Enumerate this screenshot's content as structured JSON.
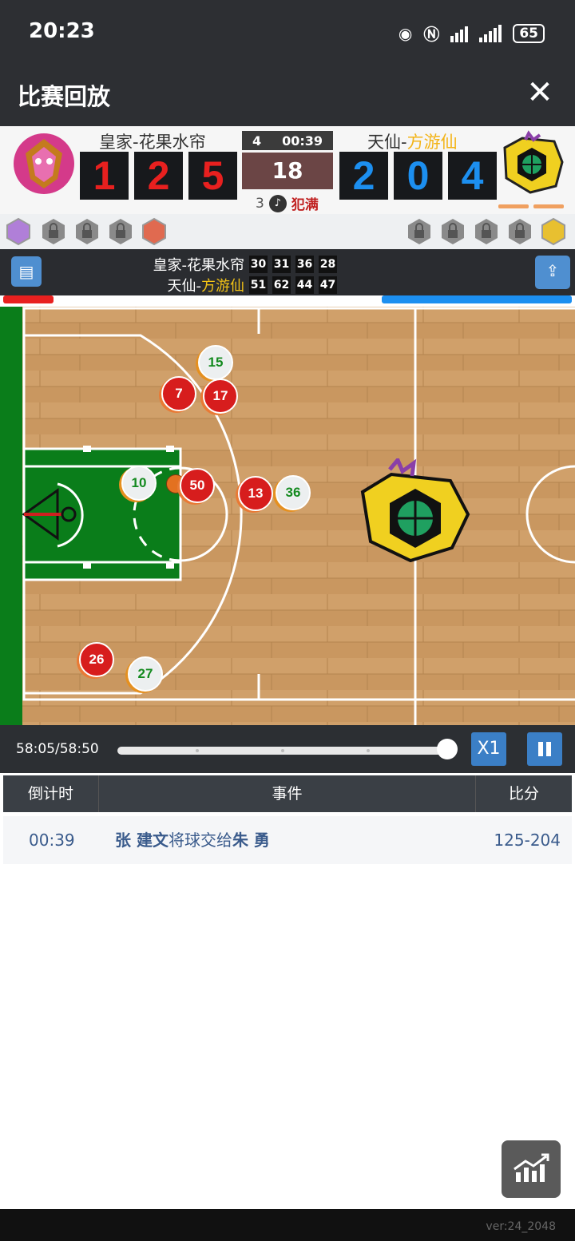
{
  "status_bar": {
    "time": "20:23",
    "battery": "65"
  },
  "header": {
    "title": "比赛回放",
    "close_label": "✕"
  },
  "scoreboard": {
    "home": {
      "name_prefix": "皇家-",
      "name": "花果水帘",
      "score_digits": [
        "1",
        "2",
        "5"
      ]
    },
    "away": {
      "name_prefix": "天仙-",
      "name": "方游仙",
      "score_digits": [
        "2",
        "0",
        "4"
      ]
    },
    "period": "4",
    "game_clock": "00:39",
    "shot_clock": "18",
    "fouls": "3",
    "foul_status": "犯满"
  },
  "quarter_scores": {
    "home": {
      "name_prefix": "皇家-",
      "name": "花果水帘",
      "scores": [
        "30",
        "31",
        "36",
        "28"
      ]
    },
    "away": {
      "name_prefix": "天仙-",
      "name": "方游仙",
      "scores": [
        "51",
        "62",
        "44",
        "47"
      ]
    }
  },
  "court": {
    "home_players": [
      "7",
      "17",
      "50",
      "13",
      "26"
    ],
    "away_players": [
      "15",
      "10",
      "36",
      "27"
    ]
  },
  "playback": {
    "time_label": "58:05/58:50",
    "progress": 0.987,
    "speed_label": "X1"
  },
  "events_table": {
    "headers": [
      "倒计时",
      "事件",
      "比分"
    ],
    "rows": [
      {
        "time": "00:39",
        "player_from": "张 建文",
        "action": "将球交给",
        "player_to": "朱 勇",
        "score": "125-204"
      }
    ]
  },
  "footer": {
    "version": "ver:24_2048"
  },
  "colors": {
    "home": "#e8201f",
    "away": "#1c8ff0",
    "accent": "#3b7fc6"
  }
}
